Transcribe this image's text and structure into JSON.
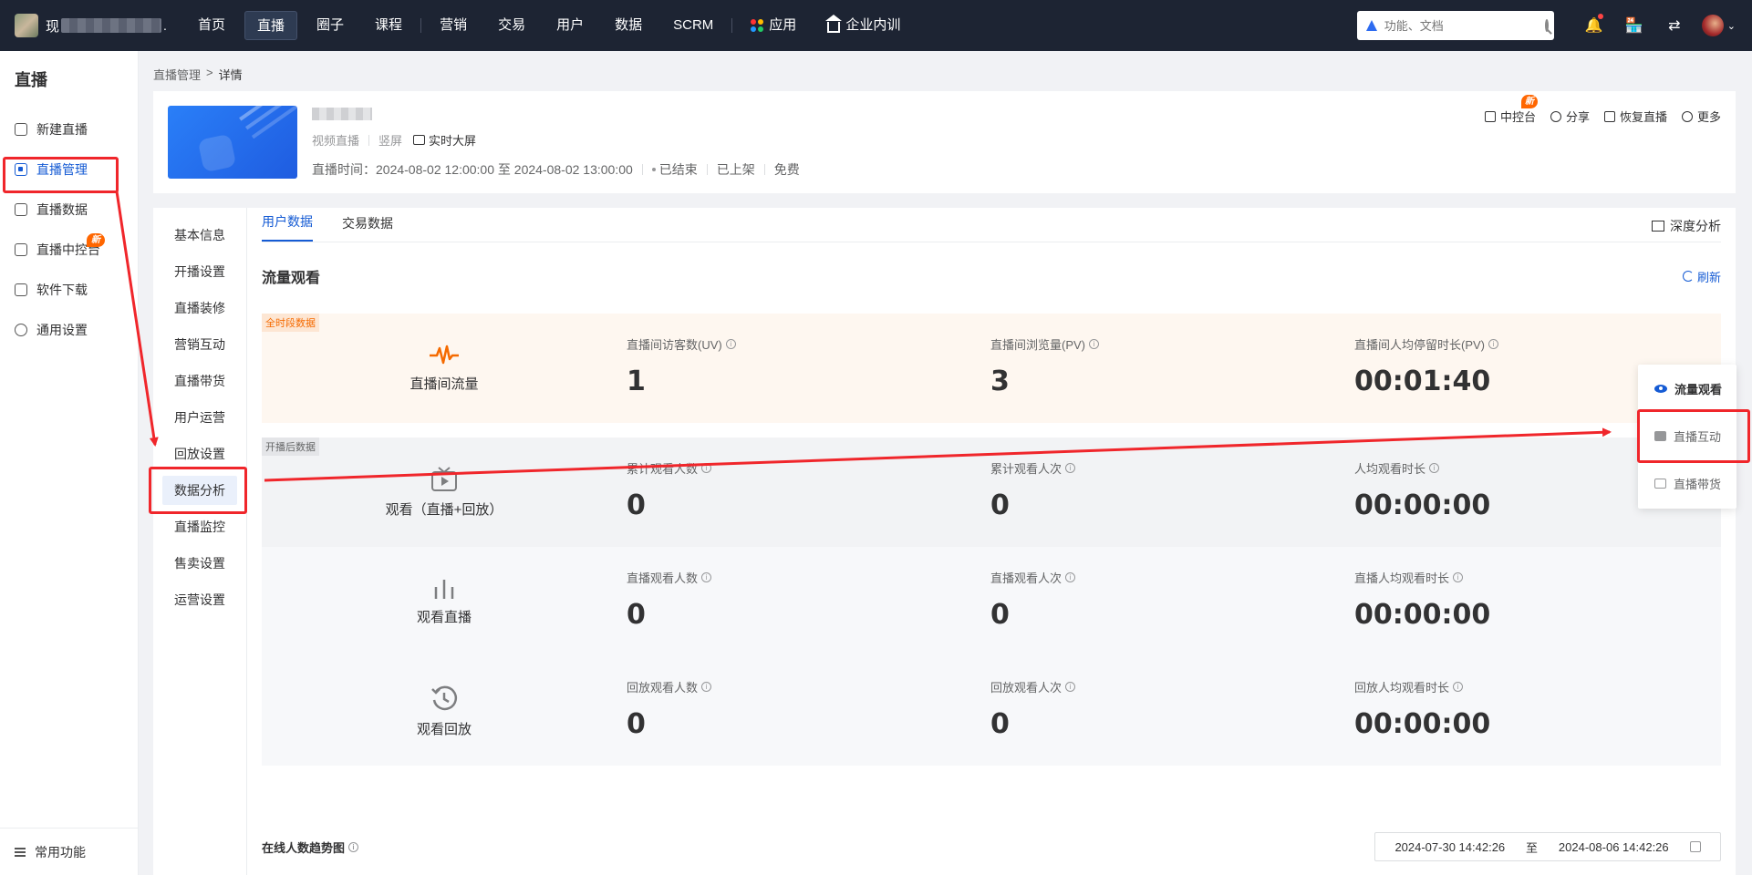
{
  "topbar": {
    "shop_name": "现",
    "shop_suffix": ".",
    "nav": [
      "首页",
      "直播",
      "圈子",
      "课程",
      "营销",
      "交易",
      "用户",
      "数据",
      "SCRM"
    ],
    "app_label": "应用",
    "training_label": "企业内训",
    "search_placeholder": "功能、文档"
  },
  "sidebar": {
    "title": "直播",
    "items": [
      {
        "label": "新建直播"
      },
      {
        "label": "直播管理"
      },
      {
        "label": "直播数据"
      },
      {
        "label": "直播中控台",
        "badge": "新"
      },
      {
        "label": "软件下载"
      },
      {
        "label": "通用设置"
      }
    ],
    "footer": "常用功能"
  },
  "breadcrumb": {
    "parent": "直播管理",
    "sep": ">",
    "current": "详情"
  },
  "live": {
    "type": "视频直播",
    "orientation": "竖屏",
    "bigscreen": "实时大屏",
    "time_label": "直播时间：2024-08-02 12:00:00 至 2024-08-02 13:00:00",
    "status": "已结束",
    "shelf": "已上架",
    "price": "免费",
    "actions": {
      "console": "中控台",
      "console_badge": "新",
      "share": "分享",
      "restore": "恢复直播",
      "more": "更多"
    }
  },
  "subnav": [
    "基本信息",
    "开播设置",
    "直播装修",
    "营销互动",
    "直播带货",
    "用户运营",
    "回放设置",
    "数据分析",
    "直播监控",
    "售卖设置",
    "运营设置"
  ],
  "tabs": [
    "用户数据",
    "交易数据"
  ],
  "deep_analysis": "深度分析",
  "section": {
    "title": "流量观看",
    "refresh": "刷新"
  },
  "blocks": [
    {
      "tag": "全时段数据",
      "label": "直播间流量",
      "metrics": [
        {
          "label": "直播间访客数(UV)",
          "value": "1"
        },
        {
          "label": "直播间浏览量(PV)",
          "value": "3"
        },
        {
          "label": "直播间人均停留时长(PV)",
          "value": "00:01:40"
        }
      ]
    },
    {
      "tag": "开播后数据",
      "label": "观看（直播+回放）",
      "metrics": [
        {
          "label": "累计观看人数",
          "value": "0"
        },
        {
          "label": "累计观看人次",
          "value": "0"
        },
        {
          "label": "人均观看时长",
          "value": "00:00:00"
        }
      ]
    },
    {
      "tag": "",
      "label": "观看直播",
      "metrics": [
        {
          "label": "直播观看人数",
          "value": "0"
        },
        {
          "label": "直播观看人次",
          "value": "0"
        },
        {
          "label": "直播人均观看时长",
          "value": "00:00:00"
        }
      ]
    },
    {
      "tag": "",
      "label": "观看回放",
      "metrics": [
        {
          "label": "回放观看人数",
          "value": "0"
        },
        {
          "label": "回放观看人次",
          "value": "0"
        },
        {
          "label": "回放人均观看时长",
          "value": "00:00:00"
        }
      ]
    }
  ],
  "trend": {
    "title": "在线人数趋势图",
    "start": "2024-07-30 14:42:26",
    "sep": "至",
    "end": "2024-08-06 14:42:26"
  },
  "float_menu": [
    "流量观看",
    "直播互动",
    "直播带货"
  ],
  "colors": {
    "topbar": "#1d2433",
    "primary": "#155bd4",
    "annotation": "#f0262b",
    "badge": "#ff6600"
  }
}
